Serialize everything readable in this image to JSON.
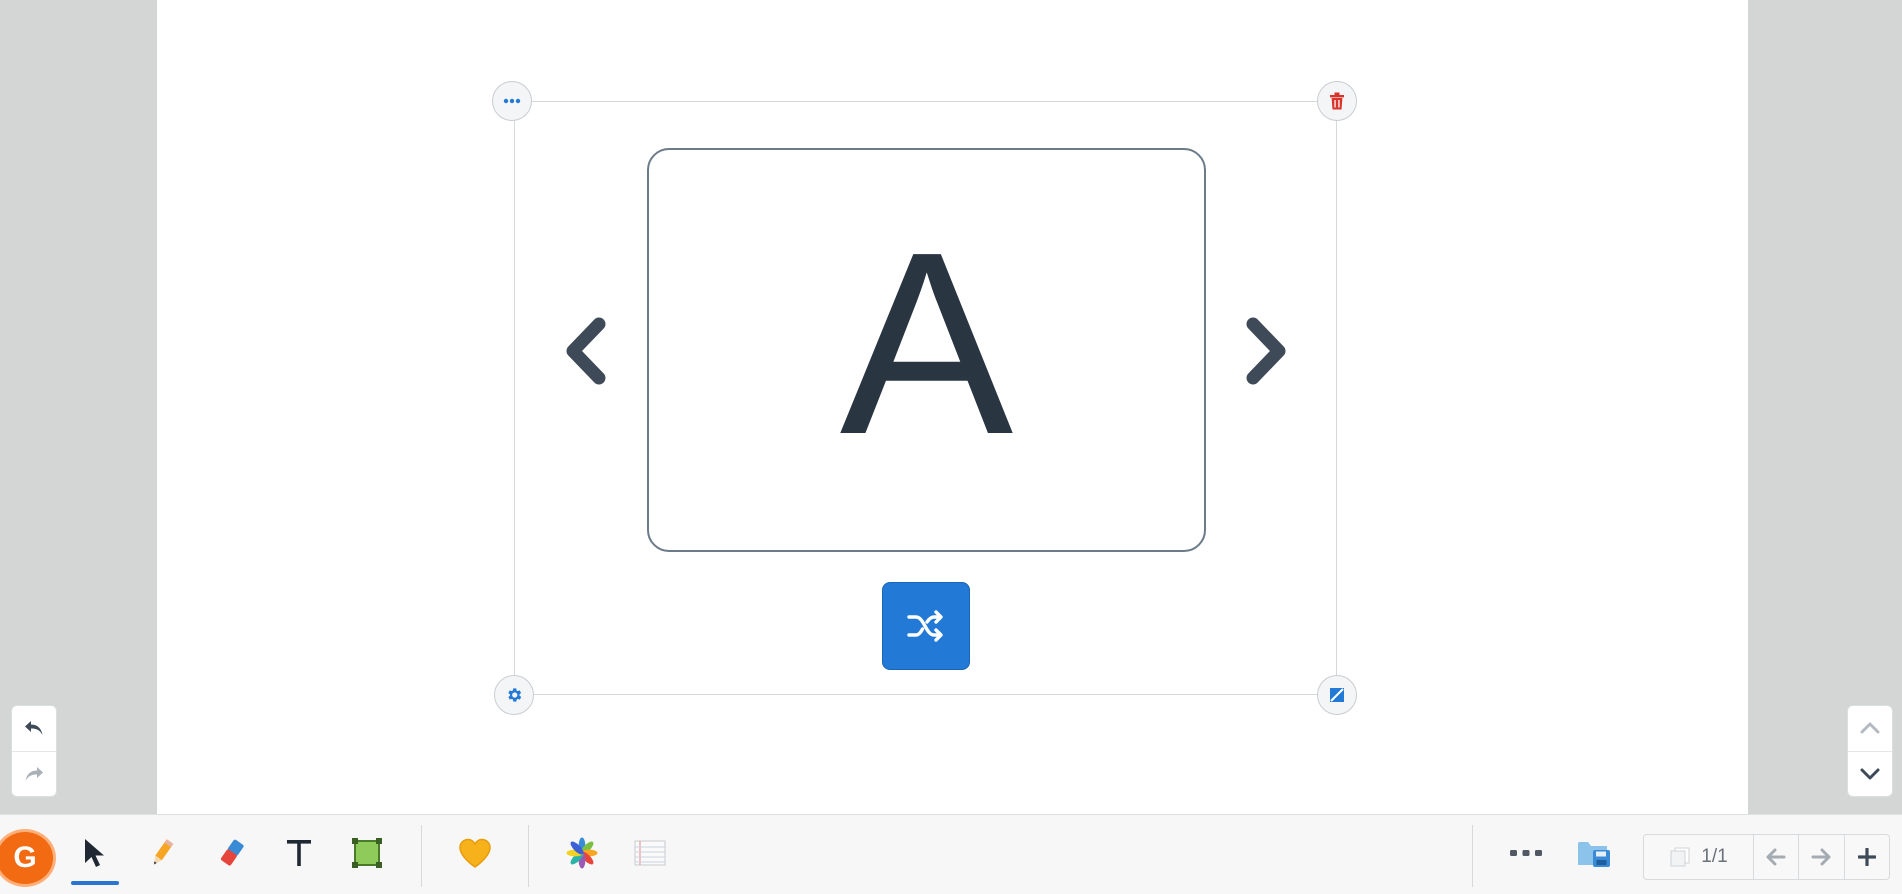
{
  "card": {
    "letter": "A"
  },
  "pager": {
    "page_indicator": "1/1"
  },
  "logo": {
    "letter": "G"
  },
  "colors": {
    "accent": "#2279d6",
    "delete": "#d9342b",
    "text_dark": "#2a3542",
    "logo": "#f26a12"
  },
  "icons": {
    "frame_menu": "ellipsis-icon",
    "frame_delete": "trash-icon",
    "frame_settings": "gear-icon",
    "frame_resize": "resize-icon",
    "prev": "chevron-left-icon",
    "next": "chevron-right-icon",
    "shuffle": "shuffle-icon",
    "undo": "undo-icon",
    "redo": "redo-icon",
    "scroll_up": "chevron-up-icon",
    "scroll_down": "chevron-down-icon"
  },
  "toolbar": {
    "tools": [
      "select",
      "pencil",
      "eraser",
      "text",
      "shape"
    ],
    "active_tool": "select",
    "extras": [
      "stickers",
      "apps",
      "notes",
      "more",
      "save"
    ]
  }
}
